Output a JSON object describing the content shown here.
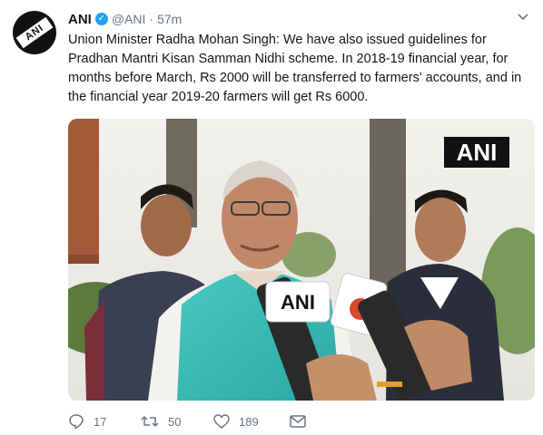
{
  "tweet": {
    "author_name": "ANI",
    "handle": "@ANI",
    "separator": "·",
    "time": "57m",
    "text": "Union Minister Radha Mohan Singh: We have also issued guidelines for Pradhan Mantri Kisan Samman Nidhi scheme. In 2018-19 financial year, for months before March, Rs 2000 will be transferred to farmers' accounts, and in the financial year 2019-20 farmers will get Rs 6000.",
    "avatar_mark": "ANI"
  },
  "media": {
    "watermark": "ANI",
    "mic_left_label": "ANI"
  },
  "actions": {
    "reply_count": "17",
    "retweet_count": "50",
    "like_count": "189"
  },
  "icons": {
    "verified": "verified-badge-icon",
    "menu": "chevron-down-icon",
    "reply": "reply-icon",
    "retweet": "retweet-icon",
    "like": "heart-icon",
    "message": "envelope-icon"
  },
  "colors": {
    "text": "#14171a",
    "secondary": "#657786",
    "verified": "#1da1f2"
  }
}
